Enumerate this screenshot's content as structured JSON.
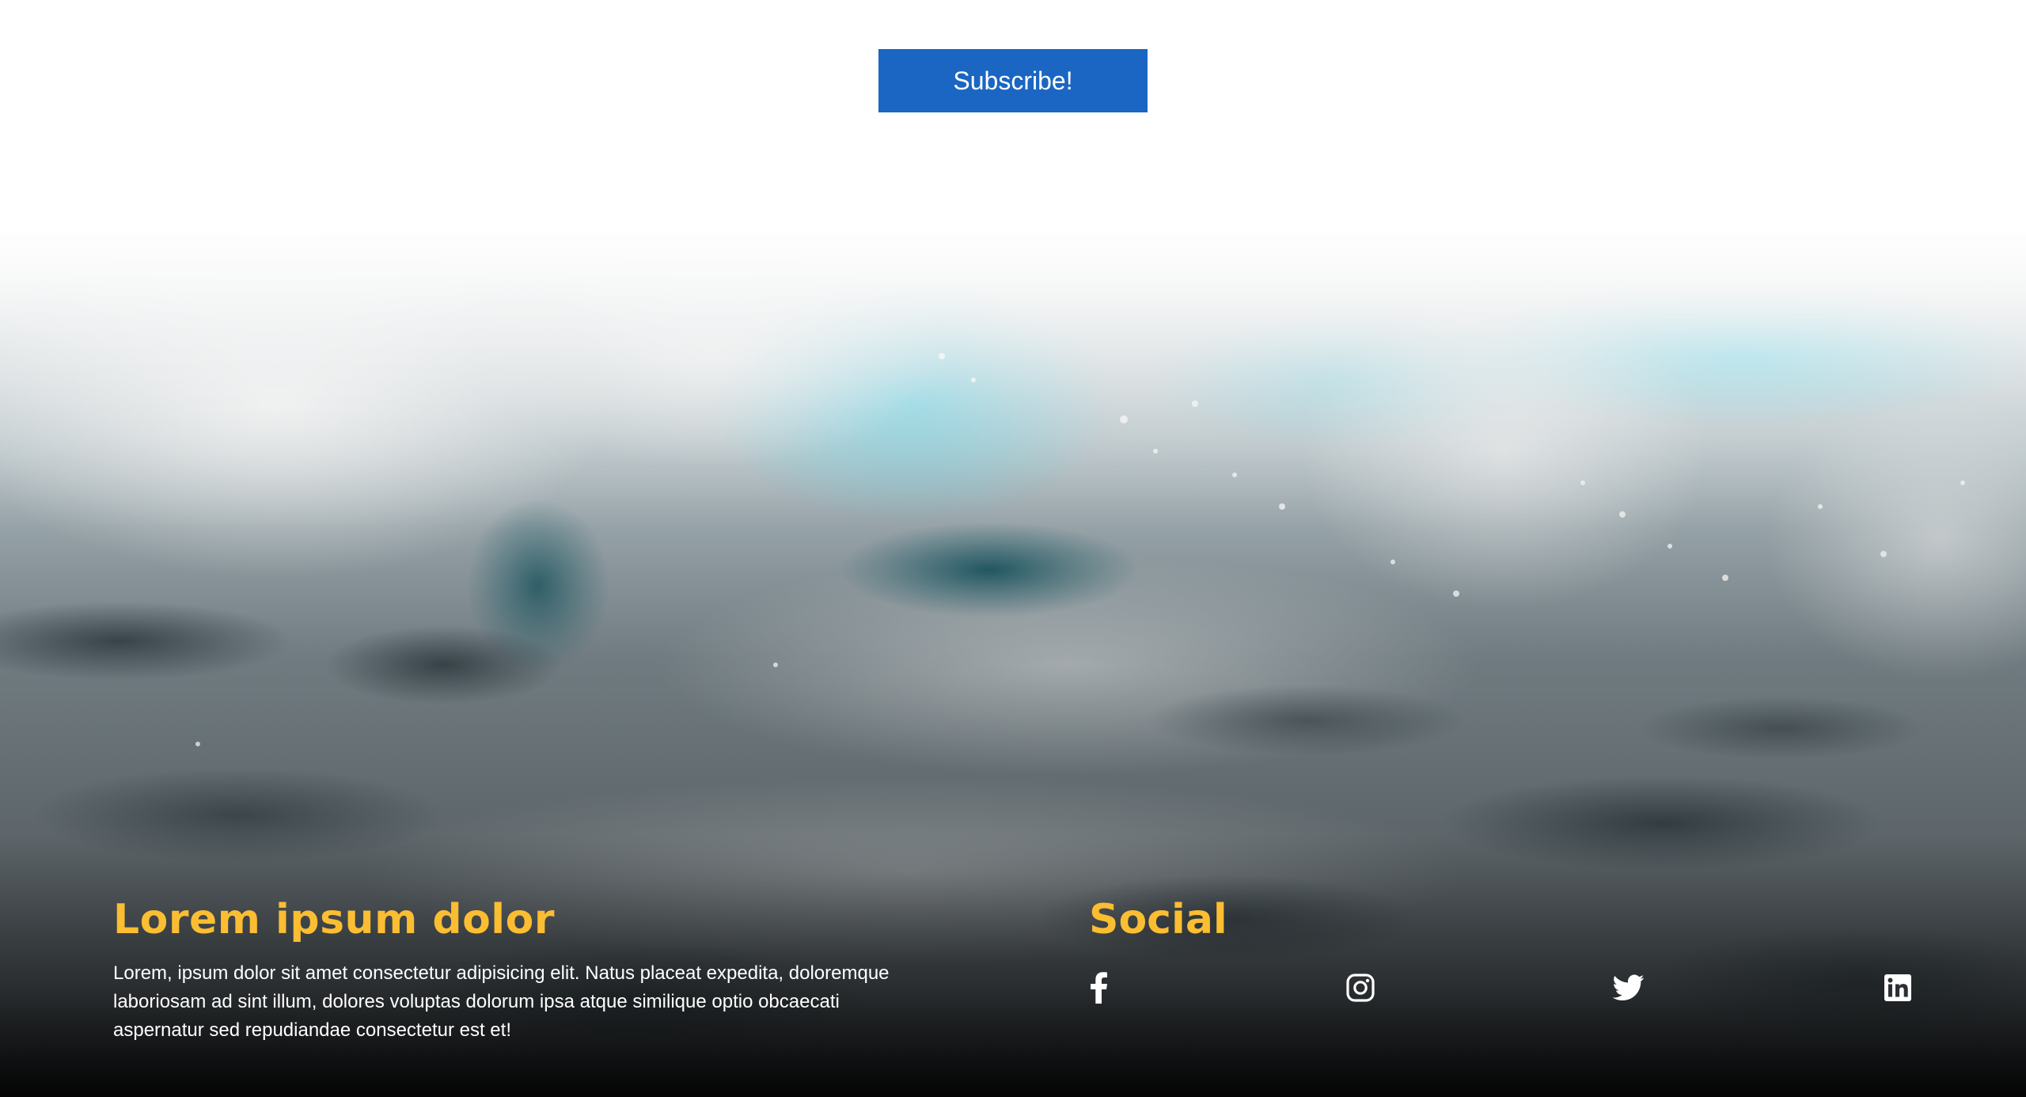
{
  "subscribe": {
    "label": "Subscribe!",
    "color": "#1a66c2"
  },
  "footer": {
    "about": {
      "title": "Lorem ipsum dolor",
      "text": "Lorem, ipsum dolor sit amet consectetur adipisicing elit. Natus placeat expedita, doloremque laboriosam ad sint illum, dolores voluptas dolorum ipsa atque similique optio obcaecati aspernatur sed repudiandae consectetur est et!"
    },
    "social": {
      "title": "Social",
      "links": [
        {
          "icon": "facebook-icon"
        },
        {
          "icon": "instagram-icon"
        },
        {
          "icon": "twitter-icon"
        },
        {
          "icon": "linkedin-icon"
        }
      ]
    },
    "accent_color": "#fbbd32",
    "background": "ocean-wave-photo"
  }
}
